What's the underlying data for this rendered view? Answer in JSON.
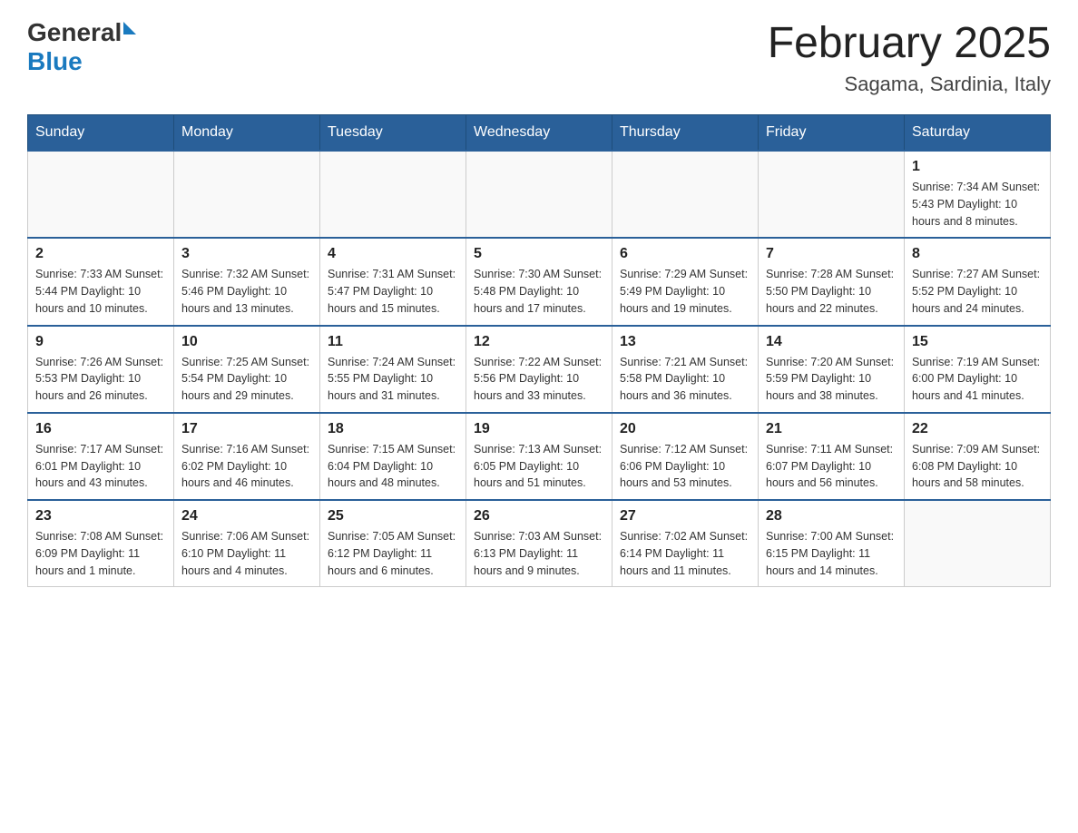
{
  "header": {
    "logo_general": "General",
    "logo_blue": "Blue",
    "month_title": "February 2025",
    "location": "Sagama, Sardinia, Italy"
  },
  "days_of_week": [
    "Sunday",
    "Monday",
    "Tuesday",
    "Wednesday",
    "Thursday",
    "Friday",
    "Saturday"
  ],
  "weeks": [
    [
      {
        "day": "",
        "info": ""
      },
      {
        "day": "",
        "info": ""
      },
      {
        "day": "",
        "info": ""
      },
      {
        "day": "",
        "info": ""
      },
      {
        "day": "",
        "info": ""
      },
      {
        "day": "",
        "info": ""
      },
      {
        "day": "1",
        "info": "Sunrise: 7:34 AM\nSunset: 5:43 PM\nDaylight: 10 hours and 8 minutes."
      }
    ],
    [
      {
        "day": "2",
        "info": "Sunrise: 7:33 AM\nSunset: 5:44 PM\nDaylight: 10 hours and 10 minutes."
      },
      {
        "day": "3",
        "info": "Sunrise: 7:32 AM\nSunset: 5:46 PM\nDaylight: 10 hours and 13 minutes."
      },
      {
        "day": "4",
        "info": "Sunrise: 7:31 AM\nSunset: 5:47 PM\nDaylight: 10 hours and 15 minutes."
      },
      {
        "day": "5",
        "info": "Sunrise: 7:30 AM\nSunset: 5:48 PM\nDaylight: 10 hours and 17 minutes."
      },
      {
        "day": "6",
        "info": "Sunrise: 7:29 AM\nSunset: 5:49 PM\nDaylight: 10 hours and 19 minutes."
      },
      {
        "day": "7",
        "info": "Sunrise: 7:28 AM\nSunset: 5:50 PM\nDaylight: 10 hours and 22 minutes."
      },
      {
        "day": "8",
        "info": "Sunrise: 7:27 AM\nSunset: 5:52 PM\nDaylight: 10 hours and 24 minutes."
      }
    ],
    [
      {
        "day": "9",
        "info": "Sunrise: 7:26 AM\nSunset: 5:53 PM\nDaylight: 10 hours and 26 minutes."
      },
      {
        "day": "10",
        "info": "Sunrise: 7:25 AM\nSunset: 5:54 PM\nDaylight: 10 hours and 29 minutes."
      },
      {
        "day": "11",
        "info": "Sunrise: 7:24 AM\nSunset: 5:55 PM\nDaylight: 10 hours and 31 minutes."
      },
      {
        "day": "12",
        "info": "Sunrise: 7:22 AM\nSunset: 5:56 PM\nDaylight: 10 hours and 33 minutes."
      },
      {
        "day": "13",
        "info": "Sunrise: 7:21 AM\nSunset: 5:58 PM\nDaylight: 10 hours and 36 minutes."
      },
      {
        "day": "14",
        "info": "Sunrise: 7:20 AM\nSunset: 5:59 PM\nDaylight: 10 hours and 38 minutes."
      },
      {
        "day": "15",
        "info": "Sunrise: 7:19 AM\nSunset: 6:00 PM\nDaylight: 10 hours and 41 minutes."
      }
    ],
    [
      {
        "day": "16",
        "info": "Sunrise: 7:17 AM\nSunset: 6:01 PM\nDaylight: 10 hours and 43 minutes."
      },
      {
        "day": "17",
        "info": "Sunrise: 7:16 AM\nSunset: 6:02 PM\nDaylight: 10 hours and 46 minutes."
      },
      {
        "day": "18",
        "info": "Sunrise: 7:15 AM\nSunset: 6:04 PM\nDaylight: 10 hours and 48 minutes."
      },
      {
        "day": "19",
        "info": "Sunrise: 7:13 AM\nSunset: 6:05 PM\nDaylight: 10 hours and 51 minutes."
      },
      {
        "day": "20",
        "info": "Sunrise: 7:12 AM\nSunset: 6:06 PM\nDaylight: 10 hours and 53 minutes."
      },
      {
        "day": "21",
        "info": "Sunrise: 7:11 AM\nSunset: 6:07 PM\nDaylight: 10 hours and 56 minutes."
      },
      {
        "day": "22",
        "info": "Sunrise: 7:09 AM\nSunset: 6:08 PM\nDaylight: 10 hours and 58 minutes."
      }
    ],
    [
      {
        "day": "23",
        "info": "Sunrise: 7:08 AM\nSunset: 6:09 PM\nDaylight: 11 hours and 1 minute."
      },
      {
        "day": "24",
        "info": "Sunrise: 7:06 AM\nSunset: 6:10 PM\nDaylight: 11 hours and 4 minutes."
      },
      {
        "day": "25",
        "info": "Sunrise: 7:05 AM\nSunset: 6:12 PM\nDaylight: 11 hours and 6 minutes."
      },
      {
        "day": "26",
        "info": "Sunrise: 7:03 AM\nSunset: 6:13 PM\nDaylight: 11 hours and 9 minutes."
      },
      {
        "day": "27",
        "info": "Sunrise: 7:02 AM\nSunset: 6:14 PM\nDaylight: 11 hours and 11 minutes."
      },
      {
        "day": "28",
        "info": "Sunrise: 7:00 AM\nSunset: 6:15 PM\nDaylight: 11 hours and 14 minutes."
      },
      {
        "day": "",
        "info": ""
      }
    ]
  ]
}
